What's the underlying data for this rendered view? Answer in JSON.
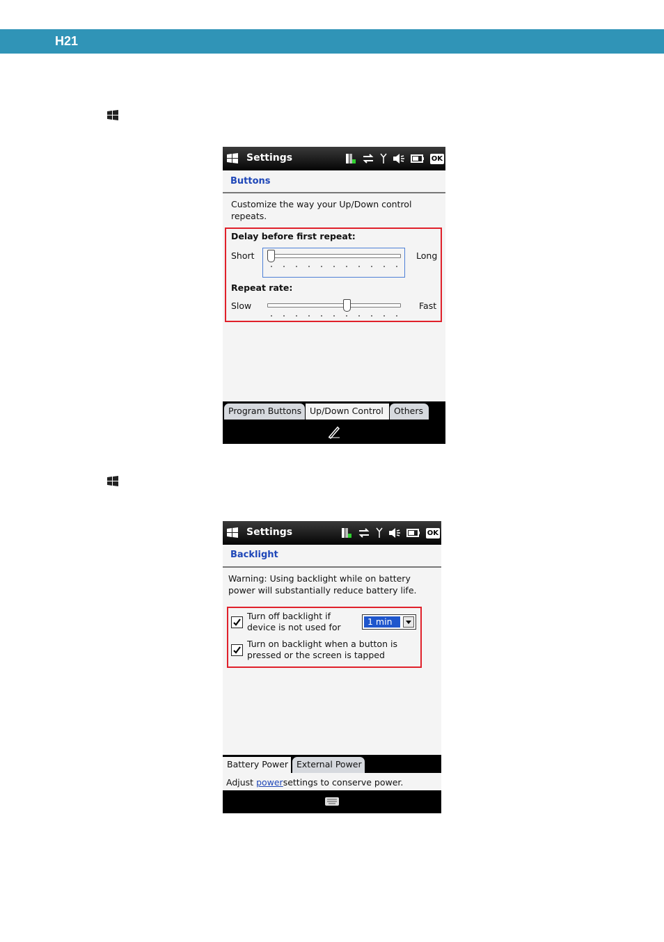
{
  "header": {
    "title": "H21",
    "color": "#3094b7"
  },
  "start_icon": "windows-flag-icon",
  "screen1": {
    "app_title": "Settings",
    "status_icons": [
      "battery-charging-icon",
      "sync-arrows-icon",
      "antenna-icon",
      "speaker-muted-icon",
      "battery-icon"
    ],
    "ok_label": "OK",
    "section": "Buttons",
    "description": "Customize the way your Up/Down control repeats.",
    "delay_label": "Delay before first repeat:",
    "delay_min": "Short",
    "delay_max": "Long",
    "delay_value": 0.0,
    "rate_label": "Repeat rate:",
    "rate_min": "Slow",
    "rate_max": "Fast",
    "rate_value": 0.6,
    "tabs": [
      "Program Buttons",
      "Up/Down Control",
      "Others"
    ],
    "active_tab": "Up/Down Control",
    "sip_icon": "pen-icon"
  },
  "screen2": {
    "app_title": "Settings",
    "ok_label": "OK",
    "section": "Backlight",
    "warning": "Warning: Using backlight while on battery power will substantially reduce battery life.",
    "option1_line1": "Turn off backlight if",
    "option1_line2": "device is not used for",
    "option1_checked": true,
    "timeout_value": "1 min",
    "option2_line1": "Turn on backlight when a button is",
    "option2_line2": "pressed or the screen is tapped",
    "option2_checked": true,
    "tabs": [
      "Battery Power",
      "External Power"
    ],
    "active_tab": "Battery Power",
    "footer_prefix": "Adjust",
    "footer_link": "power",
    "footer_suffix": "settings to conserve power.",
    "sip_icon": "keyboard-icon"
  },
  "highlight_color": "#e0202a"
}
